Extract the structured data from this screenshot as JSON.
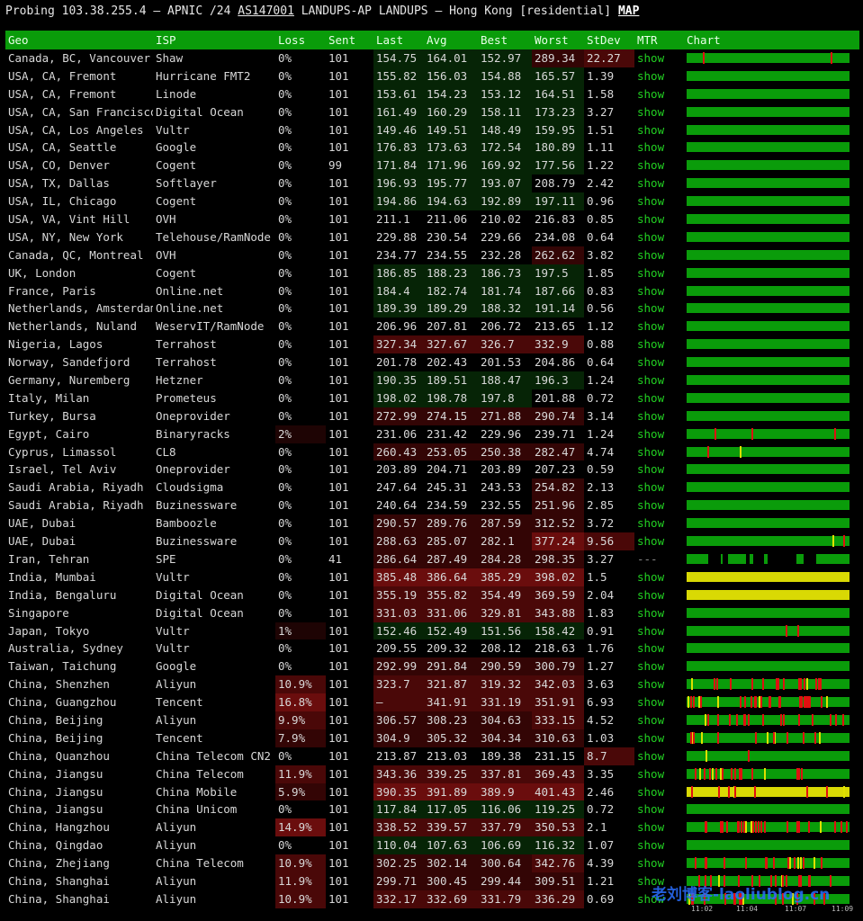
{
  "header": {
    "prefix": "Probing 103.38.255.4 – APNIC /24 ",
    "asn": "AS147001",
    "mid": " LANDUPS-AP LANDUPS – Hong Kong [residential] ",
    "map_link": "MAP"
  },
  "columns": [
    "Geo",
    "ISP",
    "Loss",
    "Sent",
    "Last",
    "Avg",
    "Best",
    "Worst",
    "StDev",
    "MTR",
    "Chart"
  ],
  "colors": {
    "green_bar": "#0a9c0a",
    "loss_spike": "#e01010",
    "jitter_spike": "#e0e000",
    "link": "#22d022"
  },
  "rows": [
    {
      "geo": "Canada, BC, Vancouver",
      "isp": "Shaw",
      "loss": "0%",
      "sent": "101",
      "last": "154.75",
      "avg": "164.01",
      "best": "152.97",
      "worst": "289.34",
      "stdev": "22.27",
      "mtr": "show"
    },
    {
      "geo": "USA, CA, Fremont",
      "isp": "Hurricane FMT2",
      "loss": "0%",
      "sent": "101",
      "last": "155.82",
      "avg": "156.03",
      "best": "154.88",
      "worst": "165.57",
      "stdev": "1.39",
      "mtr": "show"
    },
    {
      "geo": "USA, CA, Fremont",
      "isp": "Linode",
      "loss": "0%",
      "sent": "101",
      "last": "153.61",
      "avg": "154.23",
      "best": "153.12",
      "worst": "164.51",
      "stdev": "1.58",
      "mtr": "show"
    },
    {
      "geo": "USA, CA, San Francisco",
      "isp": "Digital Ocean",
      "loss": "0%",
      "sent": "101",
      "last": "161.49",
      "avg": "160.29",
      "best": "158.11",
      "worst": "173.23",
      "stdev": "3.27",
      "mtr": "show"
    },
    {
      "geo": "USA, CA, Los Angeles",
      "isp": "Vultr",
      "loss": "0%",
      "sent": "101",
      "last": "149.46",
      "avg": "149.51",
      "best": "148.49",
      "worst": "159.95",
      "stdev": "1.51",
      "mtr": "show"
    },
    {
      "geo": "USA, CA, Seattle",
      "isp": "Google",
      "loss": "0%",
      "sent": "101",
      "last": "176.83",
      "avg": "173.63",
      "best": "172.54",
      "worst": "180.89",
      "stdev": "1.11",
      "mtr": "show"
    },
    {
      "geo": "USA, CO, Denver",
      "isp": "Cogent",
      "loss": "0%",
      "sent": "99",
      "last": "171.84",
      "avg": "171.96",
      "best": "169.92",
      "worst": "177.56",
      "stdev": "1.22",
      "mtr": "show"
    },
    {
      "geo": "USA, TX, Dallas",
      "isp": "Softlayer",
      "loss": "0%",
      "sent": "101",
      "last": "196.93",
      "avg": "195.77",
      "best": "193.07",
      "worst": "208.79",
      "stdev": "2.42",
      "mtr": "show"
    },
    {
      "geo": "USA, IL, Chicago",
      "isp": "Cogent",
      "loss": "0%",
      "sent": "101",
      "last": "194.86",
      "avg": "194.63",
      "best": "192.89",
      "worst": "197.11",
      "stdev": "0.96",
      "mtr": "show"
    },
    {
      "geo": "USA, VA, Vint Hill",
      "isp": "OVH",
      "loss": "0%",
      "sent": "101",
      "last": "211.1",
      "avg": "211.06",
      "best": "210.02",
      "worst": "216.83",
      "stdev": "0.85",
      "mtr": "show"
    },
    {
      "geo": "USA, NY, New York",
      "isp": "Telehouse/RamNode",
      "loss": "0%",
      "sent": "101",
      "last": "229.88",
      "avg": "230.54",
      "best": "229.66",
      "worst": "234.08",
      "stdev": "0.64",
      "mtr": "show"
    },
    {
      "geo": "Canada, QC, Montreal",
      "isp": "OVH",
      "loss": "0%",
      "sent": "101",
      "last": "234.77",
      "avg": "234.55",
      "best": "232.28",
      "worst": "262.62",
      "stdev": "3.82",
      "mtr": "show"
    },
    {
      "geo": "UK, London",
      "isp": "Cogent",
      "loss": "0%",
      "sent": "101",
      "last": "186.85",
      "avg": "188.23",
      "best": "186.73",
      "worst": "197.5",
      "stdev": "1.85",
      "mtr": "show"
    },
    {
      "geo": "France, Paris",
      "isp": "Online.net",
      "loss": "0%",
      "sent": "101",
      "last": "184.4",
      "avg": "182.74",
      "best": "181.74",
      "worst": "187.66",
      "stdev": "0.83",
      "mtr": "show"
    },
    {
      "geo": "Netherlands, Amsterdam",
      "isp": "Online.net",
      "loss": "0%",
      "sent": "101",
      "last": "189.39",
      "avg": "189.29",
      "best": "188.32",
      "worst": "191.14",
      "stdev": "0.56",
      "mtr": "show"
    },
    {
      "geo": "Netherlands, Nuland",
      "isp": "WeservIT/RamNode",
      "loss": "0%",
      "sent": "101",
      "last": "206.96",
      "avg": "207.81",
      "best": "206.72",
      "worst": "213.65",
      "stdev": "1.12",
      "mtr": "show"
    },
    {
      "geo": "Nigeria, Lagos",
      "isp": "Terrahost",
      "loss": "0%",
      "sent": "101",
      "last": "327.34",
      "avg": "327.67",
      "best": "326.7",
      "worst": "332.9",
      "stdev": "0.88",
      "mtr": "show"
    },
    {
      "geo": "Norway, Sandefjord",
      "isp": "Terrahost",
      "loss": "0%",
      "sent": "101",
      "last": "201.78",
      "avg": "202.43",
      "best": "201.53",
      "worst": "204.86",
      "stdev": "0.64",
      "mtr": "show"
    },
    {
      "geo": "Germany, Nuremberg",
      "isp": "Hetzner",
      "loss": "0%",
      "sent": "101",
      "last": "190.35",
      "avg": "189.51",
      "best": "188.47",
      "worst": "196.3",
      "stdev": "1.24",
      "mtr": "show"
    },
    {
      "geo": "Italy, Milan",
      "isp": "Prometeus",
      "loss": "0%",
      "sent": "101",
      "last": "198.02",
      "avg": "198.78",
      "best": "197.8",
      "worst": "201.88",
      "stdev": "0.72",
      "mtr": "show"
    },
    {
      "geo": "Turkey, Bursa",
      "isp": "Oneprovider",
      "loss": "0%",
      "sent": "101",
      "last": "272.99",
      "avg": "274.15",
      "best": "271.88",
      "worst": "290.74",
      "stdev": "3.14",
      "mtr": "show"
    },
    {
      "geo": "Egypt, Cairo",
      "isp": "Binaryracks",
      "loss": "2%",
      "sent": "101",
      "last": "231.06",
      "avg": "231.42",
      "best": "229.96",
      "worst": "239.71",
      "stdev": "1.24",
      "mtr": "show"
    },
    {
      "geo": "Cyprus, Limassol",
      "isp": "CL8",
      "loss": "0%",
      "sent": "101",
      "last": "260.43",
      "avg": "253.05",
      "best": "250.38",
      "worst": "282.47",
      "stdev": "4.74",
      "mtr": "show"
    },
    {
      "geo": "Israel, Tel Aviv",
      "isp": "Oneprovider",
      "loss": "0%",
      "sent": "101",
      "last": "203.89",
      "avg": "204.71",
      "best": "203.89",
      "worst": "207.23",
      "stdev": "0.59",
      "mtr": "show"
    },
    {
      "geo": "Saudi Arabia, Riyadh",
      "isp": "Cloudsigma",
      "loss": "0%",
      "sent": "101",
      "last": "247.64",
      "avg": "245.31",
      "best": "243.53",
      "worst": "254.82",
      "stdev": "2.13",
      "mtr": "show"
    },
    {
      "geo": "Saudi Arabia, Riyadh",
      "isp": "Buzinessware",
      "loss": "0%",
      "sent": "101",
      "last": "240.64",
      "avg": "234.59",
      "best": "232.55",
      "worst": "251.96",
      "stdev": "2.85",
      "mtr": "show"
    },
    {
      "geo": "UAE, Dubai",
      "isp": "Bamboozle",
      "loss": "0%",
      "sent": "101",
      "last": "290.57",
      "avg": "289.76",
      "best": "287.59",
      "worst": "312.52",
      "stdev": "3.72",
      "mtr": "show"
    },
    {
      "geo": "UAE, Dubai",
      "isp": "Buzinessware",
      "loss": "0%",
      "sent": "101",
      "last": "288.63",
      "avg": "285.07",
      "best": "282.1",
      "worst": "377.24",
      "stdev": "9.56",
      "mtr": "show"
    },
    {
      "geo": "Iran, Tehran",
      "isp": "SPE",
      "loss": "0%",
      "sent": "41",
      "last": "286.64",
      "avg": "287.49",
      "best": "284.28",
      "worst": "298.35",
      "stdev": "3.27",
      "mtr": "---"
    },
    {
      "geo": "India, Mumbai",
      "isp": "Vultr",
      "loss": "0%",
      "sent": "101",
      "last": "385.48",
      "avg": "386.64",
      "best": "385.29",
      "worst": "398.02",
      "stdev": "1.5",
      "mtr": "show"
    },
    {
      "geo": "India, Bengaluru",
      "isp": "Digital Ocean",
      "loss": "0%",
      "sent": "101",
      "last": "355.19",
      "avg": "355.82",
      "best": "354.49",
      "worst": "369.59",
      "stdev": "2.04",
      "mtr": "show"
    },
    {
      "geo": "Singapore",
      "isp": "Digital Ocean",
      "loss": "0%",
      "sent": "101",
      "last": "331.03",
      "avg": "331.06",
      "best": "329.81",
      "worst": "343.88",
      "stdev": "1.83",
      "mtr": "show"
    },
    {
      "geo": "Japan, Tokyo",
      "isp": "Vultr",
      "loss": "1%",
      "sent": "101",
      "last": "152.46",
      "avg": "152.49",
      "best": "151.56",
      "worst": "158.42",
      "stdev": "0.91",
      "mtr": "show"
    },
    {
      "geo": "Australia, Sydney",
      "isp": "Vultr",
      "loss": "0%",
      "sent": "101",
      "last": "209.55",
      "avg": "209.32",
      "best": "208.12",
      "worst": "218.63",
      "stdev": "1.76",
      "mtr": "show"
    },
    {
      "geo": "Taiwan, Taichung",
      "isp": "Google",
      "loss": "0%",
      "sent": "101",
      "last": "292.99",
      "avg": "291.84",
      "best": "290.59",
      "worst": "300.79",
      "stdev": "1.27",
      "mtr": "show"
    },
    {
      "geo": "China, Shenzhen",
      "isp": "Aliyun",
      "loss": "10.9%",
      "sent": "101",
      "last": "323.7",
      "avg": "321.87",
      "best": "319.32",
      "worst": "342.03",
      "stdev": "3.63",
      "mtr": "show"
    },
    {
      "geo": "China, Guangzhou",
      "isp": "Tencent",
      "loss": "16.8%",
      "sent": "101",
      "last": "–",
      "avg": "341.91",
      "best": "331.19",
      "worst": "351.91",
      "stdev": "6.93",
      "mtr": "show"
    },
    {
      "geo": "China, Beijing",
      "isp": "Aliyun",
      "loss": "9.9%",
      "sent": "101",
      "last": "306.57",
      "avg": "308.23",
      "best": "304.63",
      "worst": "333.15",
      "stdev": "4.52",
      "mtr": "show"
    },
    {
      "geo": "China, Beijing",
      "isp": "Tencent",
      "loss": "7.9%",
      "sent": "101",
      "last": "304.9",
      "avg": "305.32",
      "best": "304.34",
      "worst": "310.63",
      "stdev": "1.03",
      "mtr": "show"
    },
    {
      "geo": "China, Quanzhou",
      "isp": "China Telecom CN2",
      "loss": "0%",
      "sent": "101",
      "last": "213.87",
      "avg": "213.03",
      "best": "189.38",
      "worst": "231.15",
      "stdev": "8.7",
      "mtr": "show"
    },
    {
      "geo": "China, Jiangsu",
      "isp": "China Telecom",
      "loss": "11.9%",
      "sent": "101",
      "last": "343.36",
      "avg": "339.25",
      "best": "337.81",
      "worst": "369.43",
      "stdev": "3.35",
      "mtr": "show"
    },
    {
      "geo": "China, Jiangsu",
      "isp": "China Mobile",
      "loss": "5.9%",
      "sent": "101",
      "last": "390.35",
      "avg": "391.89",
      "best": "389.9",
      "worst": "401.43",
      "stdev": "2.46",
      "mtr": "show"
    },
    {
      "geo": "China, Jiangsu",
      "isp": "China Unicom",
      "loss": "0%",
      "sent": "101",
      "last": "117.84",
      "avg": "117.05",
      "best": "116.06",
      "worst": "119.25",
      "stdev": "0.72",
      "mtr": "show"
    },
    {
      "geo": "China, Hangzhou",
      "isp": "Aliyun",
      "loss": "14.9%",
      "sent": "101",
      "last": "338.52",
      "avg": "339.57",
      "best": "337.79",
      "worst": "350.53",
      "stdev": "2.1",
      "mtr": "show"
    },
    {
      "geo": "China, Qingdao",
      "isp": "Aliyun",
      "loss": "0%",
      "sent": "101",
      "last": "110.04",
      "avg": "107.63",
      "best": "106.69",
      "worst": "116.32",
      "stdev": "1.07",
      "mtr": "show"
    },
    {
      "geo": "China, Zhejiang",
      "isp": "China Telecom",
      "loss": "10.9%",
      "sent": "101",
      "last": "302.25",
      "avg": "302.14",
      "best": "300.64",
      "worst": "342.76",
      "stdev": "4.39",
      "mtr": "show"
    },
    {
      "geo": "China, Shanghai",
      "isp": "Aliyun",
      "loss": "11.9%",
      "sent": "101",
      "last": "299.71",
      "avg": "300.45",
      "best": "299.44",
      "worst": "309.51",
      "stdev": "1.21",
      "mtr": "show"
    },
    {
      "geo": "China, Shanghai",
      "isp": "Aliyun",
      "loss": "10.9%",
      "sent": "101",
      "last": "332.17",
      "avg": "332.69",
      "best": "331.79",
      "worst": "336.29",
      "stdev": "0.69",
      "mtr": "show"
    }
  ],
  "chart_times": [
    "11:02",
    "11:04",
    "11:07",
    "11:09"
  ],
  "watermark": "老刘博客-laoliublog.cn"
}
